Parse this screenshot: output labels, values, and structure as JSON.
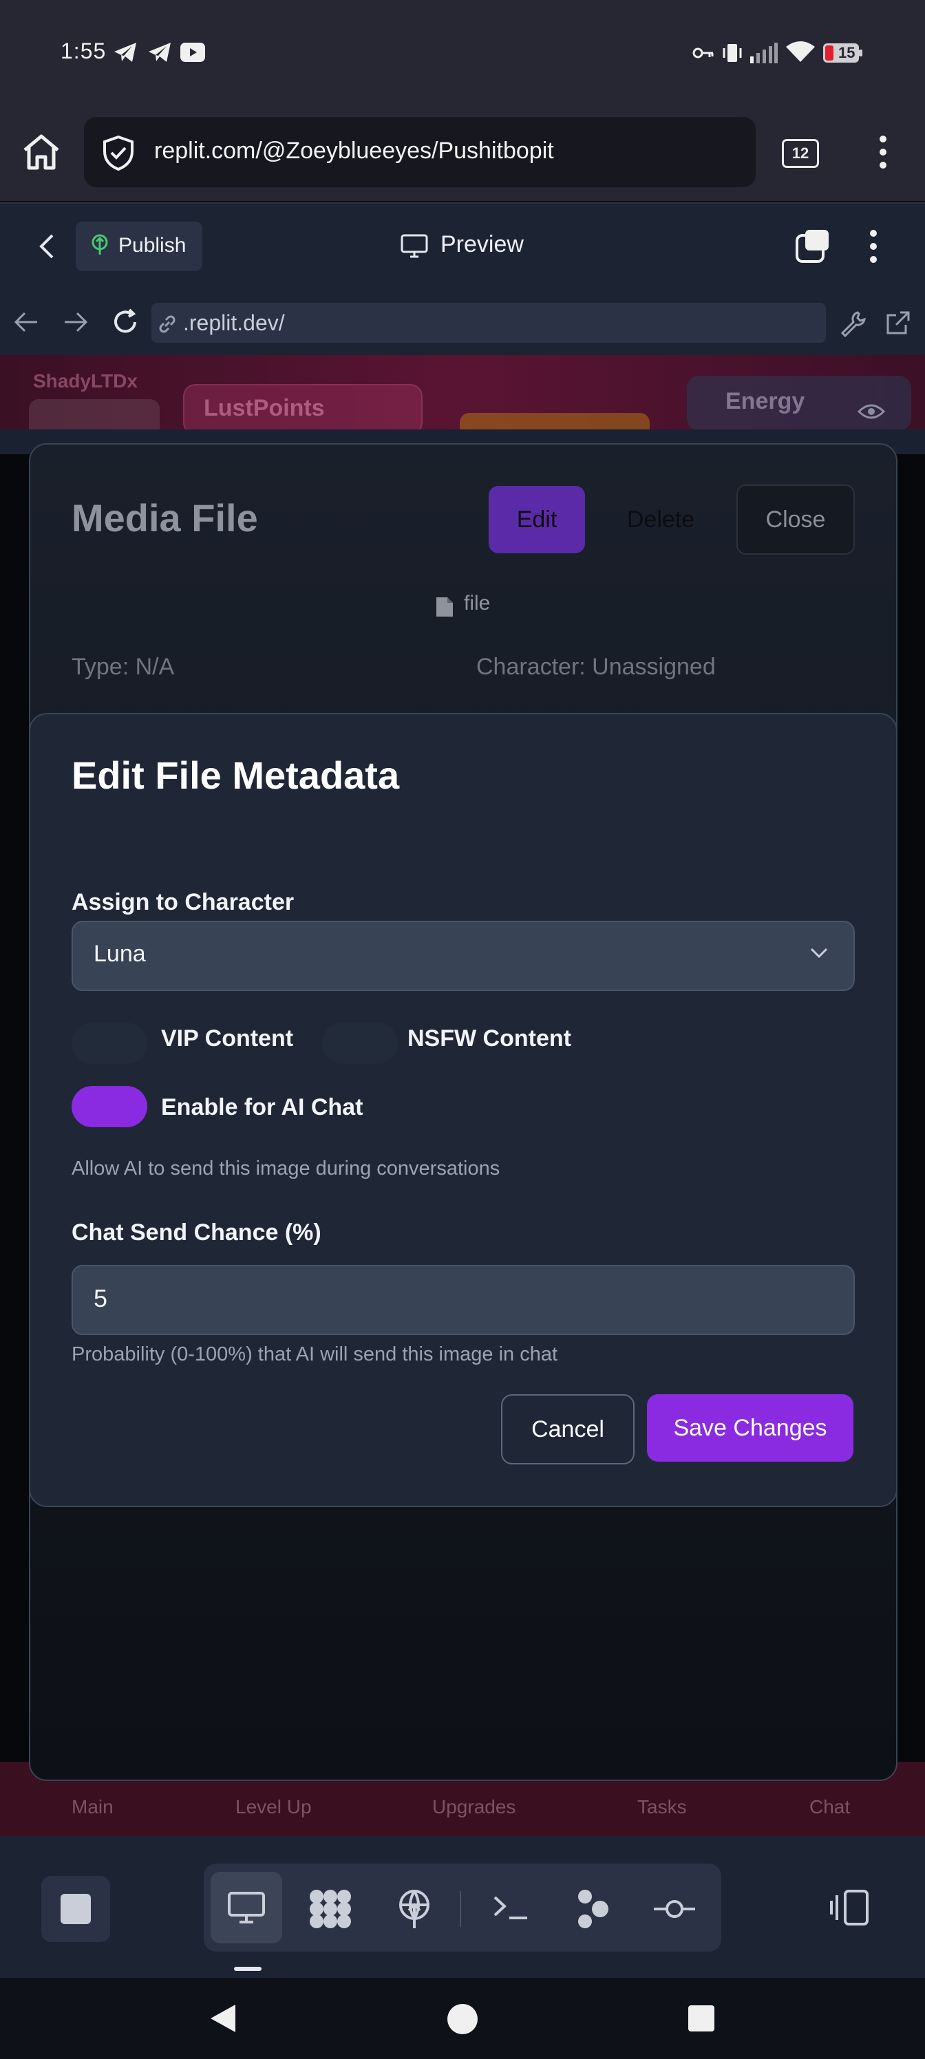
{
  "status_bar": {
    "time": "1:55",
    "battery": "15",
    "icons": [
      "telegram-icon",
      "telegram-icon",
      "youtube-icon",
      "vpn-key-icon",
      "vibrate-icon",
      "signal-icon",
      "wifi-icon",
      "battery-icon"
    ]
  },
  "browser": {
    "url": "replit.com/@Zoeyblueeyes/Pushitbopit",
    "tab_count": "12"
  },
  "replit_toolbar": {
    "publish_label": "Publish",
    "preview_label": "Preview"
  },
  "preview_nav": {
    "address": ".replit.dev/"
  },
  "app": {
    "username": "ShadyLTDx",
    "lust_points_label": "LustPoints",
    "energy_label": "Energy",
    "bottom_tabs": [
      "Main",
      "Level Up",
      "Upgrades",
      "Tasks",
      "Chat"
    ]
  },
  "media_panel": {
    "title": "Media File",
    "edit_label": "Edit",
    "delete_label": "Delete",
    "close_label": "Close",
    "file_label": "file",
    "type_text": "Type: N/A",
    "character_text": "Character: Unassigned"
  },
  "edit_modal": {
    "title": "Edit File Metadata",
    "assign_label": "Assign to Character",
    "assign_value": "Luna",
    "vip_label": "VIP Content",
    "nsfw_label": "NSFW Content",
    "ai_chat_label": "Enable for AI Chat",
    "ai_chat_hint": "Allow AI to send this image during conversations",
    "chance_label": "Chat Send Chance (%)",
    "chance_value": "5",
    "chance_hint": "Probability (0-100%) that AI will send this image in chat",
    "cancel_label": "Cancel",
    "save_label": "Save Changes",
    "ai_chat_enabled": true,
    "accent_color": "#8a2be2"
  }
}
